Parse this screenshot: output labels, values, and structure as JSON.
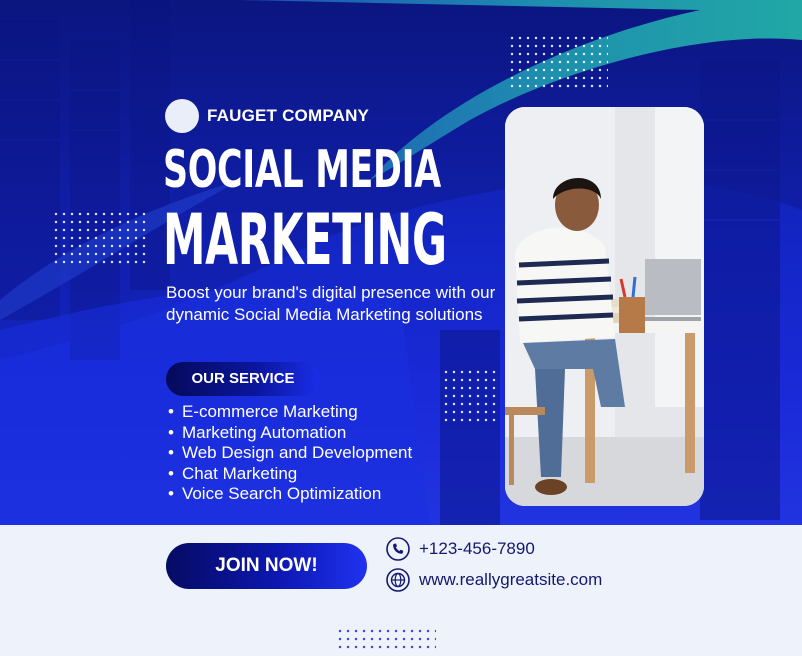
{
  "company": {
    "name": "FAUGET COMPANY",
    "logo": "circle-logo"
  },
  "headline": {
    "line1": "SOCIAL MEDIA",
    "line2": "MARKETING"
  },
  "description": "Boost your brand's digital presence with our dynamic Social Media Marketing solutions",
  "services": {
    "heading": "OUR SERVICE",
    "items": [
      "E-commerce Marketing",
      "Marketing Automation",
      "Web Design and Development",
      "Chat Marketing",
      "Voice Search Optimization"
    ]
  },
  "cta": {
    "label": "JOIN NOW!"
  },
  "contact": {
    "phone": "+123-456-7890",
    "website": "www.reallygreatsite.com",
    "phone_icon": "phone-icon",
    "web_icon": "globe-icon"
  },
  "colors": {
    "primary": "#1326c4",
    "dark": "#0a0f6e",
    "accent_teal": "#1ea4a8",
    "light": "#eef2fb",
    "text_dark": "#14196e"
  }
}
